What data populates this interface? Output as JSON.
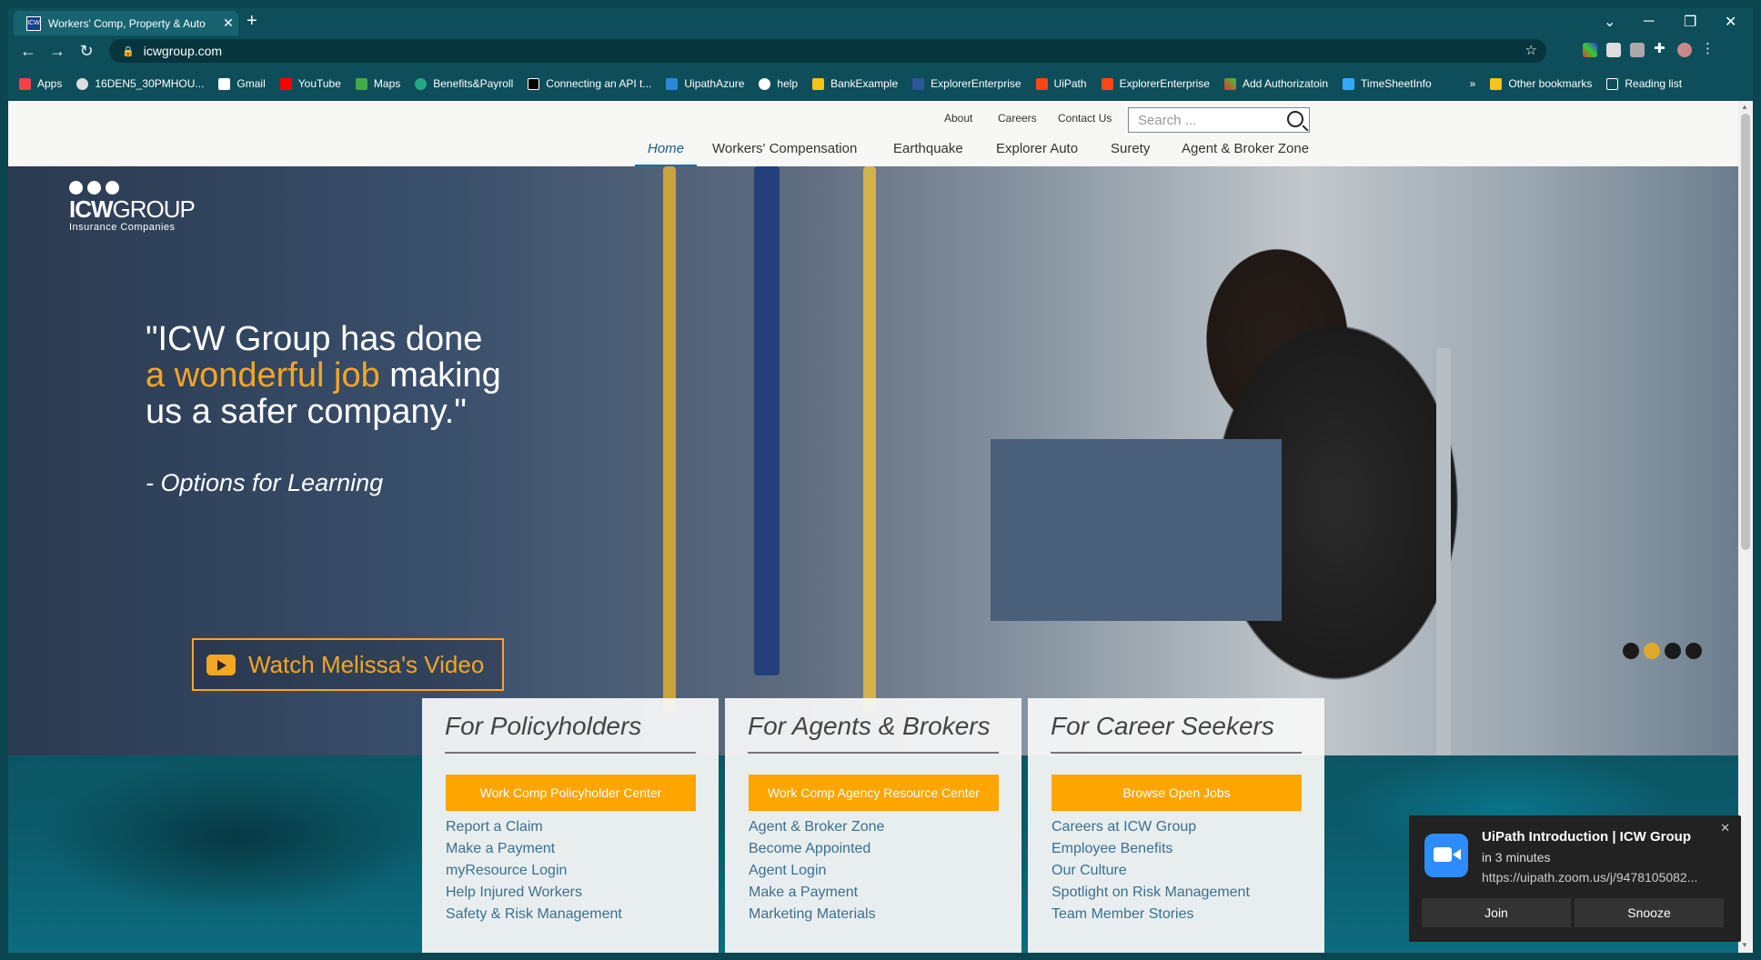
{
  "browser": {
    "tab_title": "Workers' Comp, Property & Auto",
    "new_tab": "+",
    "url": "icwgroup.com",
    "bookmarks": [
      "Apps",
      "16DEN5_30PMHOU...",
      "Gmail",
      "YouTube",
      "Maps",
      "Benefits&Payroll",
      "Connecting an API t...",
      "UipathAzure",
      "help",
      "BankExample",
      "ExplorerEnterprise",
      "UiPath",
      "ExplorerEnterprise",
      "Add Authorizatoin",
      "TimeSheetInfo"
    ],
    "bookmark_overflow": "»",
    "other_bookmarks": "Other bookmarks",
    "reading_list": "Reading list"
  },
  "site": {
    "util_nav": [
      "About",
      "Careers",
      "Contact Us"
    ],
    "search_placeholder": "Search ...",
    "main_nav": [
      "Home",
      "Workers' Compensation",
      "Earthquake",
      "Explorer Auto",
      "Surety",
      "Agent & Broker Zone"
    ],
    "logo": {
      "name_bold": "ICW",
      "name_rest": "GROUP",
      "sub": "Insurance Companies"
    },
    "hero": {
      "quote_line1": "\"ICW Group has done",
      "quote_highlight": "a wonderful job",
      "quote_line2_rest": " making",
      "quote_line3": "us a safer company.\"",
      "attribution": "- Options for Learning",
      "video_button": "Watch Melissa's Video",
      "carousel_active_index": 1
    },
    "cards": [
      {
        "title": "For Policyholders",
        "cta": "Work Comp Policyholder Center",
        "links": [
          "Report a Claim",
          "Make a Payment",
          "myResource Login",
          "Help Injured Workers",
          "Safety & Risk Management"
        ]
      },
      {
        "title": "For Agents & Brokers",
        "cta": "Work Comp Agency Resource Center",
        "links": [
          "Agent & Broker Zone",
          "Become Appointed",
          "Agent Login",
          "Make a Payment",
          "Marketing Materials"
        ]
      },
      {
        "title": "For Career Seekers",
        "cta": "Browse Open Jobs",
        "links": [
          "Careers at ICW Group",
          "Employee Benefits",
          "Our Culture",
          "Spotlight on Risk Management",
          "Team Member Stories"
        ]
      }
    ]
  },
  "toast": {
    "title": "UiPath Introduction | ICW Group",
    "time": "in 3 minutes",
    "link": "https://uipath.zoom.us/j/9478105082...",
    "join": "Join",
    "snooze": "Snooze"
  },
  "colors": {
    "accent": "#ffa500",
    "chrome": "#0d4e5a",
    "link": "#3b6f8f"
  }
}
